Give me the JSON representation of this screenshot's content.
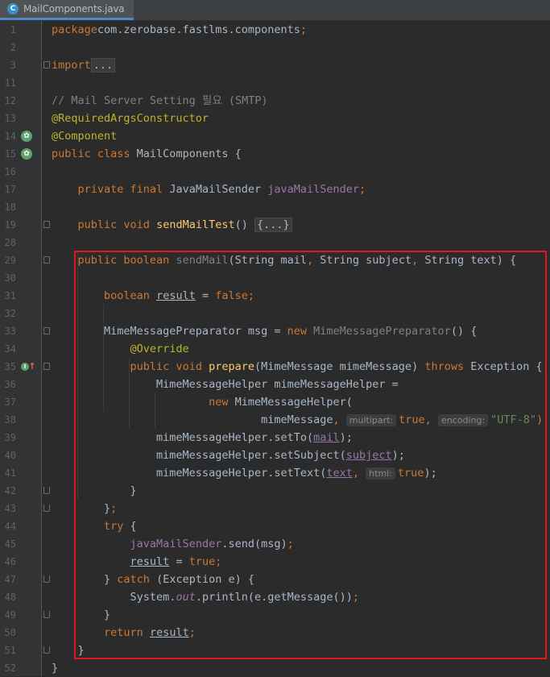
{
  "tab": {
    "icon_letter": "C",
    "filename": "MailComponents.java"
  },
  "lines": [
    {
      "n": "1",
      "tokens": [
        [
          "kw",
          "package"
        ],
        [
          "",
          "com.zerobase.fastlms.components"
        ],
        [
          "kw",
          ";"
        ]
      ]
    },
    {
      "n": "2",
      "tokens": []
    },
    {
      "n": "3",
      "tokens": [
        [
          "kw",
          "import"
        ],
        [
          "",
          ""
        ],
        [
          "fold-box",
          "..."
        ]
      ]
    },
    {
      "n": "11",
      "tokens": []
    },
    {
      "n": "12",
      "tokens": [
        [
          "cm",
          "// Mail Server Setting 필요 (SMTP)"
        ]
      ]
    },
    {
      "n": "13",
      "tokens": [
        [
          "ann",
          "@RequiredArgsConstructor"
        ]
      ]
    },
    {
      "n": "14",
      "tokens": [
        [
          "ann",
          "@Component"
        ]
      ]
    },
    {
      "n": "15",
      "tokens": [
        [
          "kw",
          "public class "
        ],
        [
          "",
          "MailComponents {"
        ]
      ]
    },
    {
      "n": "16",
      "tokens": []
    },
    {
      "n": "17",
      "tokens": [
        [
          "",
          "    "
        ],
        [
          "kw",
          "private final "
        ],
        [
          "",
          "JavaMailSender "
        ],
        [
          "fld",
          "javaMailSender"
        ],
        [
          "kw",
          ";"
        ]
      ]
    },
    {
      "n": "18",
      "tokens": []
    },
    {
      "n": "19",
      "tokens": [
        [
          "",
          "    "
        ],
        [
          "kw",
          "public void "
        ],
        [
          "fn",
          "sendMailTest"
        ],
        [
          "",
          "() "
        ],
        [
          "fold-box",
          "{...}"
        ]
      ]
    },
    {
      "n": "28",
      "tokens": []
    },
    {
      "n": "29",
      "tokens": [
        [
          "",
          "    "
        ],
        [
          "kw",
          "public boolean "
        ],
        [
          "gray",
          "sendMail"
        ],
        [
          "",
          "(String mail"
        ],
        [
          "kw",
          ", "
        ],
        [
          "",
          "String subject"
        ],
        [
          "kw",
          ", "
        ],
        [
          "",
          "String text) {"
        ]
      ]
    },
    {
      "n": "30",
      "tokens": []
    },
    {
      "n": "31",
      "tokens": [
        [
          "",
          "        "
        ],
        [
          "kw",
          "boolean "
        ],
        [
          "ul",
          "result"
        ],
        [
          "",
          " = "
        ],
        [
          "kw",
          "false;"
        ]
      ]
    },
    {
      "n": "32",
      "tokens": []
    },
    {
      "n": "33",
      "tokens": [
        [
          "",
          "        MimeMessagePreparator msg = "
        ],
        [
          "kw",
          "new "
        ],
        [
          "gray",
          "MimeMessagePreparator"
        ],
        [
          "",
          "() {"
        ]
      ]
    },
    {
      "n": "34",
      "tokens": [
        [
          "",
          "            "
        ],
        [
          "ann",
          "@Override"
        ]
      ]
    },
    {
      "n": "35",
      "tokens": [
        [
          "",
          "            "
        ],
        [
          "kw",
          "public void "
        ],
        [
          "fn",
          "prepare"
        ],
        [
          "",
          "(MimeMessage mimeMessage) "
        ],
        [
          "kw",
          "throws "
        ],
        [
          "",
          "Exception {"
        ]
      ]
    },
    {
      "n": "36",
      "tokens": [
        [
          "",
          "                MimeMessageHelper mimeMessageHelper ="
        ]
      ]
    },
    {
      "n": "37",
      "tokens": [
        [
          "",
          "                        "
        ],
        [
          "kw",
          "new "
        ],
        [
          "",
          "MimeMessageHelper("
        ]
      ]
    },
    {
      "n": "38",
      "tokens": [
        [
          "",
          "                                mimeMessage"
        ],
        [
          "kw",
          ", "
        ],
        [
          "hint",
          "multipart:"
        ],
        [
          "kw",
          "true, "
        ],
        [
          "hint",
          "encoding:"
        ],
        [
          "str",
          "\"UTF-8\""
        ],
        [
          "kw",
          ");"
        ]
      ]
    },
    {
      "n": "39",
      "tokens": [
        [
          "",
          "                mimeMessageHelper.setTo("
        ],
        [
          "un",
          "mail"
        ],
        [
          "",
          "); "
        ]
      ]
    },
    {
      "n": "40",
      "tokens": [
        [
          "",
          "                mimeMessageHelper.setSubject("
        ],
        [
          "un",
          "subject"
        ],
        [
          "",
          ");"
        ]
      ]
    },
    {
      "n": "41",
      "tokens": [
        [
          "",
          "                mimeMessageHelper.setText("
        ],
        [
          "un",
          "text"
        ],
        [
          "kw",
          ", "
        ],
        [
          "hint",
          "html:"
        ],
        [
          "kw",
          "true"
        ],
        [
          "",
          ");"
        ]
      ]
    },
    {
      "n": "42",
      "tokens": [
        [
          "",
          "            }"
        ]
      ]
    },
    {
      "n": "43",
      "tokens": [
        [
          "",
          "        }"
        ],
        [
          "kw",
          ";"
        ]
      ]
    },
    {
      "n": "44",
      "tokens": [
        [
          "",
          "        "
        ],
        [
          "kw",
          "try "
        ],
        [
          "",
          "{"
        ]
      ]
    },
    {
      "n": "45",
      "tokens": [
        [
          "",
          "            "
        ],
        [
          "fld",
          "javaMailSender"
        ],
        [
          "",
          ".send(msg)"
        ],
        [
          "kw",
          ";"
        ]
      ]
    },
    {
      "n": "46",
      "tokens": [
        [
          "",
          "            "
        ],
        [
          "ul",
          "result"
        ],
        [
          "",
          " = "
        ],
        [
          "kw",
          "true;"
        ]
      ]
    },
    {
      "n": "47",
      "tokens": [
        [
          "",
          "        } "
        ],
        [
          "kw",
          "catch "
        ],
        [
          "",
          "(Exception e) {"
        ]
      ]
    },
    {
      "n": "48",
      "tokens": [
        [
          "",
          "            System."
        ],
        [
          "fld-it",
          "out"
        ],
        [
          "",
          ".println(e.getMessage())"
        ],
        [
          "kw",
          ";"
        ]
      ]
    },
    {
      "n": "49",
      "tokens": [
        [
          "",
          "        }"
        ]
      ]
    },
    {
      "n": "50",
      "tokens": [
        [
          "",
          "        "
        ],
        [
          "kw",
          "return "
        ],
        [
          "ul",
          "result"
        ],
        [
          "kw",
          ";"
        ]
      ]
    },
    {
      "n": "51",
      "tokens": [
        [
          "",
          "    }"
        ]
      ]
    },
    {
      "n": "52",
      "tokens": [
        [
          "",
          "}"
        ]
      ]
    }
  ],
  "gutter_icons": {
    "14": "bean-icon",
    "15": "bean-icon",
    "35": "implements-method-icon"
  },
  "fold_markers": {
    "3": "start",
    "19": "start",
    "29": "start",
    "33": "start",
    "35": "start",
    "42": "end",
    "43": "end",
    "47": "end",
    "49": "end",
    "51": "end"
  },
  "colors": {
    "background": "#2b2b2b",
    "keyword": "#cc7832",
    "annotation": "#bbb529",
    "method": "#ffc66d",
    "field": "#9876aa",
    "string": "#6a8759",
    "comment": "#808080",
    "highlight_box": "#e0171f",
    "tab_accent": "#4a88c7"
  }
}
